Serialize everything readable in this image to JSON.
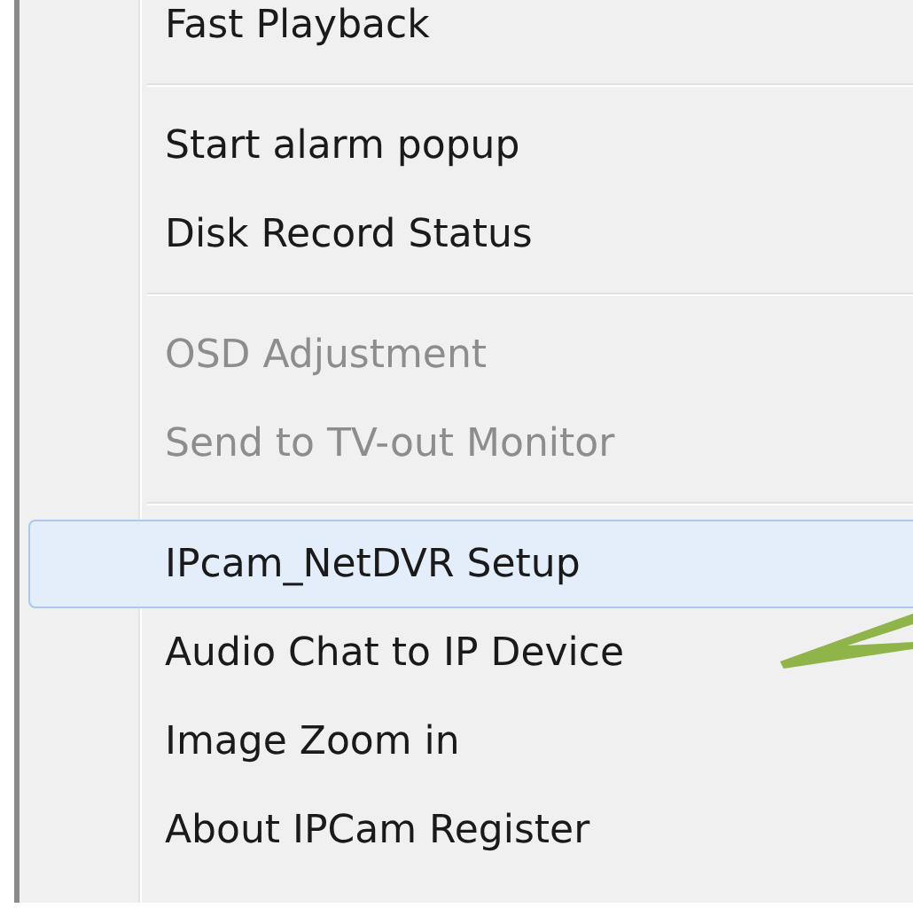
{
  "menu": {
    "items": [
      {
        "kind": "item",
        "label": "Fast Playback",
        "disabled": false,
        "selected": false
      },
      {
        "kind": "separator"
      },
      {
        "kind": "item",
        "label": "Start alarm popup",
        "disabled": false,
        "selected": false
      },
      {
        "kind": "item",
        "label": "Disk Record Status",
        "disabled": false,
        "selected": false
      },
      {
        "kind": "separator"
      },
      {
        "kind": "item",
        "label": "OSD Adjustment",
        "disabled": true,
        "selected": false
      },
      {
        "kind": "item",
        "label": "Send to TV-out Monitor",
        "disabled": true,
        "selected": false
      },
      {
        "kind": "separator"
      },
      {
        "kind": "item",
        "label": "IPcam_NetDVR Setup",
        "disabled": false,
        "selected": true
      },
      {
        "kind": "item",
        "label": "Audio Chat to IP Device",
        "disabled": false,
        "selected": false
      },
      {
        "kind": "item",
        "label": "Image Zoom in",
        "disabled": false,
        "selected": false
      },
      {
        "kind": "item",
        "label": "About IPCam Register",
        "disabled": false,
        "selected": false
      }
    ]
  }
}
